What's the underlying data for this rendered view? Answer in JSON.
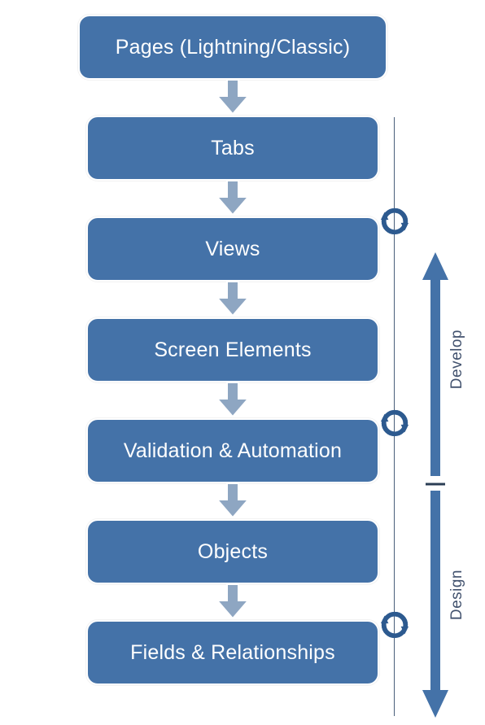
{
  "boxes": [
    {
      "label": "Pages (Lightning/Classic)"
    },
    {
      "label": "Tabs"
    },
    {
      "label": "Views"
    },
    {
      "label": "Screen Elements"
    },
    {
      "label": "Validation & Automation"
    },
    {
      "label": "Objects"
    },
    {
      "label": "Fields & Relationships"
    }
  ],
  "phases": {
    "develop": "Develop",
    "design": "Design"
  },
  "colors": {
    "fill": "#4472a8",
    "arrow": "#8ea6c2",
    "cycle": "#2d5a8f",
    "line": "#4a5f7a",
    "text": "#42526e"
  }
}
